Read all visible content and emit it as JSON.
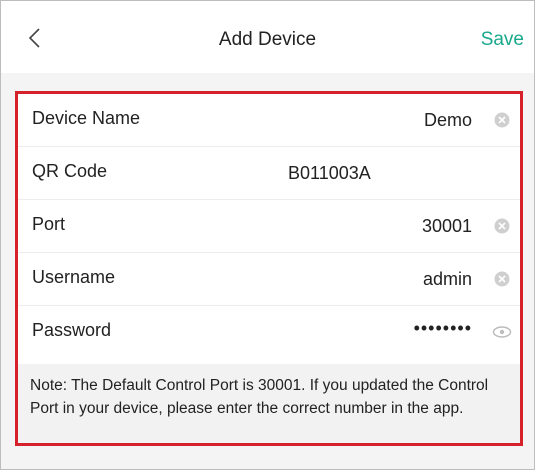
{
  "header": {
    "title": "Add Device",
    "save_label": "Save",
    "back_icon": "chevron-left-icon",
    "accent_color": "#1aa88c"
  },
  "form": {
    "border_color": "#d4212a",
    "fields": [
      {
        "label": "Device Name",
        "value": "Demo",
        "icon": "clear-icon"
      },
      {
        "label": "QR Code",
        "value": "B011003A",
        "icon": ""
      },
      {
        "label": "Port",
        "value": "30001",
        "icon": "clear-icon"
      },
      {
        "label": "Username",
        "value": "admin",
        "icon": "clear-icon"
      },
      {
        "label": "Password",
        "value": "••••••••",
        "icon": "eye-icon"
      }
    ],
    "note": "Note: The Default Control Port is 30001. If you updated the Control Port in your device, please enter the correct number in the app."
  }
}
